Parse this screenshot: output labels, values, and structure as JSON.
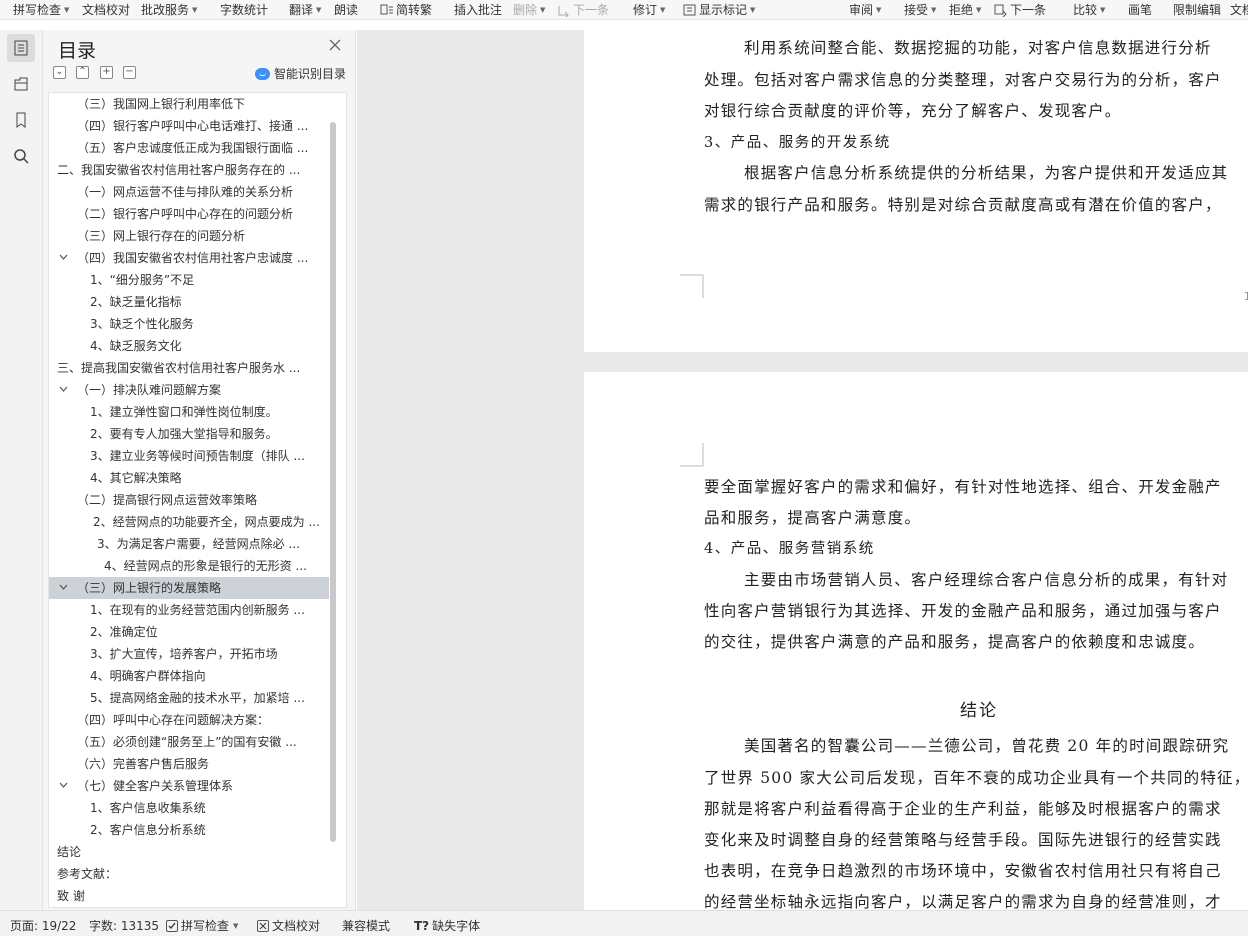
{
  "toolbar": {
    "items": [
      {
        "label": "拼写检查",
        "caret": true
      },
      {
        "label": "文档校对",
        "caret": false
      },
      {
        "label": "批改服务",
        "caret": true
      },
      {
        "label": "字数统计",
        "caret": false
      },
      {
        "label": "翻译",
        "caret": true
      },
      {
        "label": "朗读",
        "caret": false
      },
      {
        "label": "简转繁",
        "caret": false
      },
      {
        "label": "插入批注",
        "caret": false
      },
      {
        "label": "删除",
        "caret": true
      },
      {
        "label": "下一条",
        "caret": false
      },
      {
        "label": "修订",
        "caret": true
      },
      {
        "label": "显示标记",
        "caret": true
      },
      {
        "label": "审阅",
        "caret": true
      },
      {
        "label": "接受",
        "caret": true
      },
      {
        "label": "拒绝",
        "caret": true
      },
      {
        "label": "下一条",
        "caret": false
      },
      {
        "label": "比较",
        "caret": true
      },
      {
        "label": "画笔",
        "caret": false
      },
      {
        "label": "限制编辑",
        "caret": false
      },
      {
        "label": "文档",
        "caret": false
      }
    ]
  },
  "toc": {
    "title": "目录",
    "smart_label": "智能识别目录",
    "items": [
      {
        "text": "（三）我国网上银行利用率低下",
        "level": 2,
        "chevron": false,
        "selected": false
      },
      {
        "text": "（四）银行客户呼叫中心电话难打、接通 ...",
        "level": 2,
        "chevron": false,
        "selected": false
      },
      {
        "text": "（五）客户忠诚度低正成为我国银行面临 ...",
        "level": 2,
        "chevron": false,
        "selected": false
      },
      {
        "text": "二、我国安徽省农村信用社客户服务存在的 ...",
        "level": 1,
        "chevron": true,
        "selected": false
      },
      {
        "text": "（一）网点运营不佳与排队难的关系分析",
        "level": 2,
        "chevron": false,
        "selected": false
      },
      {
        "text": "（二）银行客户呼叫中心存在的问题分析",
        "level": 2,
        "chevron": false,
        "selected": false
      },
      {
        "text": "（三）网上银行存在的问题分析",
        "level": 2,
        "chevron": false,
        "selected": false
      },
      {
        "text": "（四）我国安徽省农村信用社客户忠诚度 ...",
        "level": 2,
        "chevron": true,
        "selected": false
      },
      {
        "text": "1、“细分服务”不足",
        "level": 3,
        "chevron": false,
        "selected": false
      },
      {
        "text": "2、缺乏量化指标",
        "level": 3,
        "chevron": false,
        "selected": false
      },
      {
        "text": "3、缺乏个性化服务",
        "level": 3,
        "chevron": false,
        "selected": false
      },
      {
        "text": "4、缺乏服务文化",
        "level": 3,
        "chevron": false,
        "selected": false
      },
      {
        "text": "三、提高我国安徽省农村信用社客户服务水 ...",
        "level": 1,
        "chevron": true,
        "selected": false
      },
      {
        "text": "（一）排决队难问题解方案",
        "level": 2,
        "chevron": true,
        "selected": false
      },
      {
        "text": "1、建立弹性窗口和弹性岗位制度。",
        "level": 3,
        "chevron": false,
        "selected": false
      },
      {
        "text": "2、要有专人加强大堂指导和服务。",
        "level": 3,
        "chevron": false,
        "selected": false
      },
      {
        "text": "3、建立业务等候时间预告制度（排队 ...",
        "level": 3,
        "chevron": false,
        "selected": false
      },
      {
        "text": "4、其它解决策略",
        "level": 3,
        "chevron": false,
        "selected": false
      },
      {
        "text": "（二）提高银行网点运营效率策略",
        "level": 2,
        "chevron": false,
        "selected": false
      },
      {
        "text": "2、经营网点的功能要齐全，网点要成为 ...",
        "level": 2.5,
        "chevron": false,
        "selected": false
      },
      {
        "text": "3、为满足客户需要，经营网点除必 ...",
        "level": 4,
        "chevron": false,
        "selected": false
      },
      {
        "text": "4、经营网点的形象是银行的无形资 ...",
        "level": 3.5,
        "chevron": false,
        "selected": false
      },
      {
        "text": "（三）网上银行的发展策略",
        "level": 2,
        "chevron": true,
        "selected": true
      },
      {
        "text": "1、在现有的业务经营范围内创新服务 ...",
        "level": 3,
        "chevron": false,
        "selected": false
      },
      {
        "text": "2、准确定位",
        "level": 3,
        "chevron": false,
        "selected": false
      },
      {
        "text": "3、扩大宣传，培养客户，开拓市场",
        "level": 3,
        "chevron": false,
        "selected": false
      },
      {
        "text": "4、明确客户群体指向",
        "level": 3,
        "chevron": false,
        "selected": false
      },
      {
        "text": "5、提高网络金融的技术水平，加紧培 ...",
        "level": 3,
        "chevron": false,
        "selected": false
      },
      {
        "text": "（四）呼叫中心存在问题解决方案：",
        "level": 2,
        "chevron": false,
        "selected": false
      },
      {
        "text": "（五）必须创建“服务至上”的国有安徽 ...",
        "level": 2,
        "chevron": false,
        "selected": false
      },
      {
        "text": "（六）完善客户售后服务",
        "level": 2,
        "chevron": false,
        "selected": false
      },
      {
        "text": "（七）健全客户关系管理体系",
        "level": 2,
        "chevron": true,
        "selected": false
      },
      {
        "text": "1、客户信息收集系统",
        "level": 3,
        "chevron": false,
        "selected": false
      },
      {
        "text": "2、客户信息分析系统",
        "level": 3,
        "chevron": false,
        "selected": false
      },
      {
        "text": "结论",
        "level": 1,
        "chevron": false,
        "selected": false
      },
      {
        "text": "参考文献：",
        "level": 1,
        "chevron": false,
        "selected": false
      },
      {
        "text": "致    谢",
        "level": 1,
        "chevron": false,
        "selected": false
      }
    ]
  },
  "document": {
    "page1": {
      "lines": [
        "利用系统间整合能、数据挖掘的功能，对客户信息数据进行分析",
        "处理。包括对客户需求信息的分类整理，对客户交易行为的分析，客户",
        "对银行综合贡献度的评价等，充分了解客户、发现客户。"
      ],
      "heading": "3、产品、服务的开发系统",
      "para": [
        "根据客户信息分析系统提供的分析结果，为客户提供和开发适应其",
        "需求的银行产品和服务。特别是对综合贡献度高或有潜在价值的客户，"
      ],
      "page_no": "1"
    },
    "page2": {
      "lines": [
        "要全面掌握好客户的需求和偏好，有针对性地选择、组合、开发金融产",
        "品和服务，提高客户满意度。"
      ],
      "heading": "4、产品、服务营销系统",
      "para": [
        "主要由市场营销人员、客户经理综合客户信息分析的成果，有针对",
        "性向客户营销银行为其选择、开发的金融产品和服务，通过加强与客户",
        "的交往，提供客户满意的产品和服务，提高客户的依赖度和忠诚度。"
      ],
      "conclusion_title": "结论",
      "conclusion": [
        "美国著名的智囊公司——兰德公司，曾花费 20 年的时间跟踪研究",
        "了世界 500 家大公司后发现，百年不衰的成功企业具有一个共同的特征，",
        "那就是将客户利益看得高于企业的生产利益，能够及时根据客户的需求",
        "变化来及时调整自身的经营策略与经营手段。国际先进银行的经营实践",
        "也表明，在竞争日趋激烈的市场环境中，安徽省农村信用社只有将自己",
        "的经营坐标轴永远指向客户，以满足客户的需求为自身的经营准则，才"
      ]
    }
  },
  "status": {
    "page": "页面: 19/22",
    "words": "字数: 13135",
    "spell": "拼写检查",
    "proof": "文档校对",
    "compat": "兼容模式",
    "missing_font": "缺失字体"
  }
}
